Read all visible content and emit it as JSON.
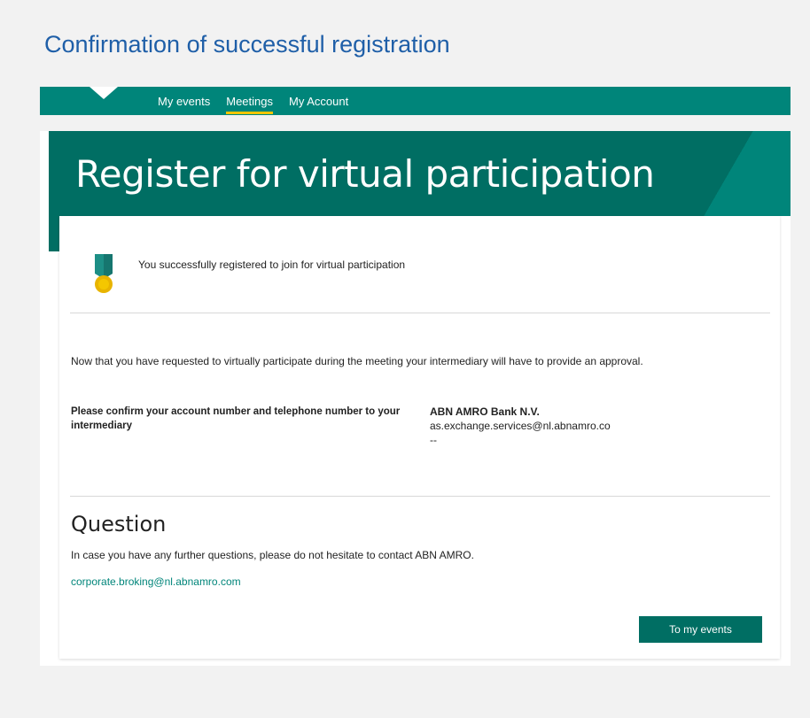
{
  "page_heading": "Confirmation of successful registration",
  "nav": {
    "items": [
      {
        "label": "My events"
      },
      {
        "label": "Meetings"
      },
      {
        "label": "My Account"
      }
    ],
    "active_index": 1
  },
  "hero": {
    "title": "Register for virtual participation"
  },
  "success": {
    "icon": "medal-icon",
    "message": "You successfully registered to join for virtual participation"
  },
  "info_text": "Now that you have requested to virtually participate during the meeting your intermediary will have to provide an approval.",
  "confirm": {
    "label": "Please confirm your account number and telephone number to your intermediary",
    "contact_name": "ABN AMRO Bank N.V.",
    "contact_email": "as.exchange.services@nl.abnamro.co",
    "contact_phone": "--"
  },
  "question": {
    "title": "Question",
    "text": "In case you have any further questions, please do not hesitate to contact ABN AMRO.",
    "email": "corporate.broking@nl.abnamro.com"
  },
  "button": {
    "label": "To my events"
  },
  "colors": {
    "brand_green": "#00857a",
    "dark_green": "#006e63",
    "accent_yellow": "#f2c500",
    "heading_blue": "#1f5fa8"
  }
}
